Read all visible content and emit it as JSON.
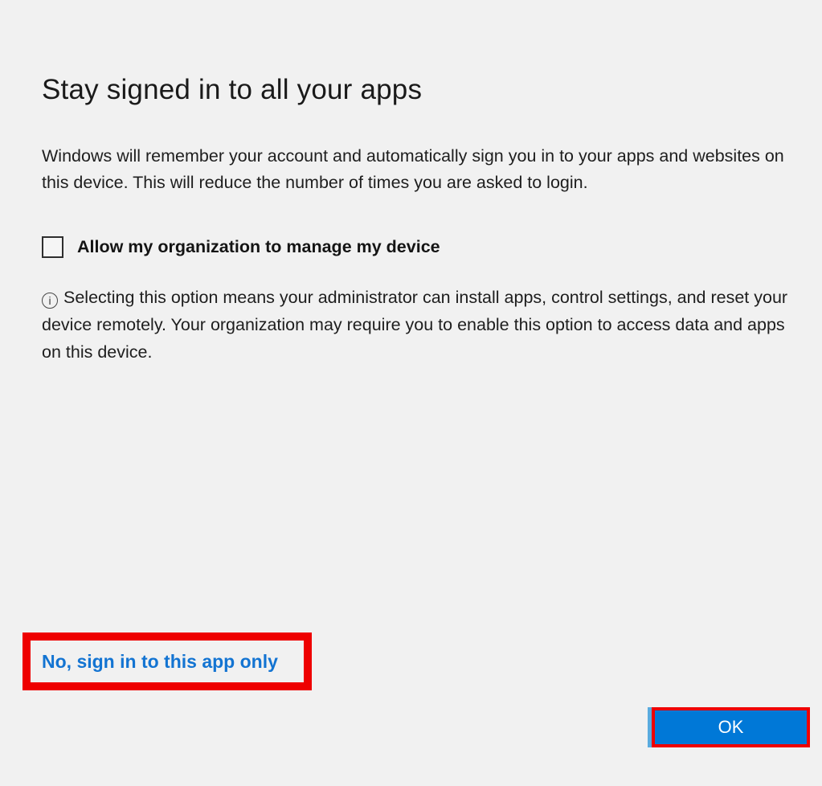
{
  "dialog": {
    "title": "Stay signed in to all your apps",
    "description": "Windows will remember your account and automatically sign you in to your apps and websites on this device. This will reduce the number of times you are asked to login.",
    "checkbox": {
      "label": "Allow my organization to manage my device",
      "checked": false
    },
    "info": {
      "icon": "info-icon",
      "icon_glyph": "i",
      "text": "Selecting this option means your administrator can install apps, control settings, and reset your device remotely. Your organization may require you to enable this option to access data and apps on this device."
    },
    "link": {
      "label": "No, sign in to this app only"
    },
    "ok_button": {
      "label": "OK"
    }
  },
  "annotations": {
    "highlighted_elements": [
      "sign-in-app-only-link",
      "ok-button"
    ]
  },
  "colors": {
    "background": "#f1f1f1",
    "text": "#1b1b1b",
    "link_blue": "#1374d2",
    "button_blue": "#0078d7",
    "button_text": "#ffffff",
    "annotation_red": "#ee0000",
    "button_edge_blue": "#5aabdf"
  }
}
